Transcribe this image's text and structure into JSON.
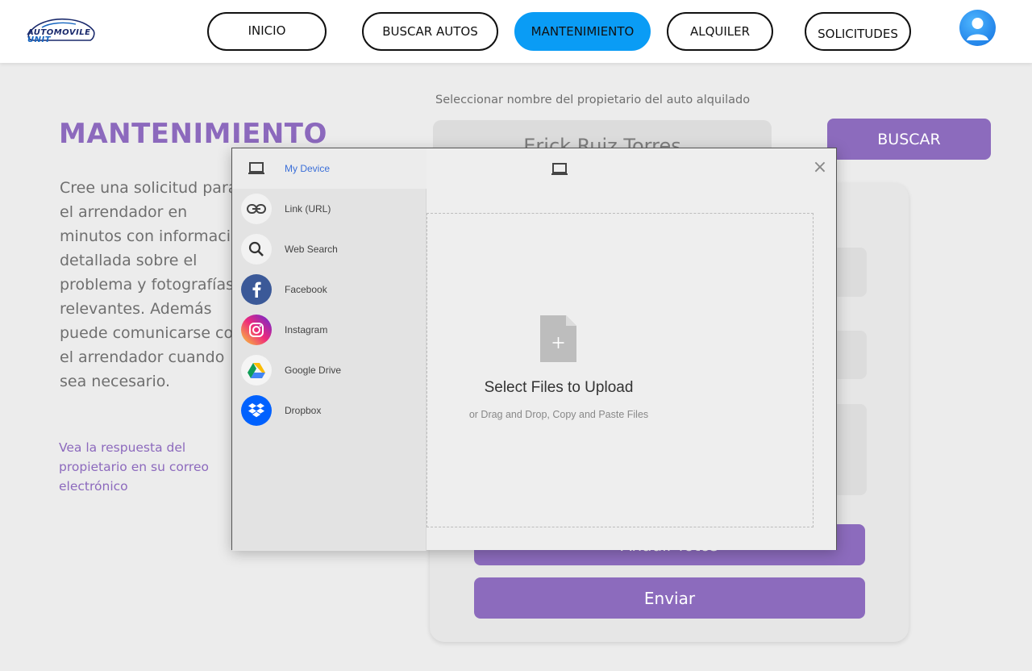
{
  "header": {
    "logo": {
      "line1": "AUTOMOVILE",
      "line2": "UNIT"
    },
    "nav": [
      {
        "label": "INICIO",
        "active": false
      },
      {
        "label": "BUSCAR AUTOS",
        "active": false
      },
      {
        "label": "MANTENIMIENTO",
        "active": true
      },
      {
        "label": "ALQUILER",
        "active": false
      },
      {
        "label": "SOLICITUDES",
        "active": false
      }
    ],
    "avatar_icon": "user-avatar-icon"
  },
  "page": {
    "title": "MANTENIMIENTO",
    "description": "Cree una solicitud para el arrendador en minutos con información detallada sobre el problema y fotografías relevantes. Además puede comunicarse con el arrendador cuando sea necesario.",
    "note": "Vea la respuesta del propietario en su correo electrónico"
  },
  "form": {
    "select_label": "Seleccionar  nombre del propietario del auto  alquilado",
    "selected_owner": "Erick Ruiz Torres",
    "search_button": "BUSCAR",
    "add_photos_button": "Añadir fotos",
    "submit_button": "Enviar"
  },
  "upload_modal": {
    "sources": [
      {
        "label": "My Device",
        "icon": "laptop-icon",
        "active": true
      },
      {
        "label": "Link (URL)",
        "icon": "link-icon",
        "active": false
      },
      {
        "label": "Web Search",
        "icon": "search-icon",
        "active": false
      },
      {
        "label": "Facebook",
        "icon": "facebook-icon",
        "active": false
      },
      {
        "label": "Instagram",
        "icon": "instagram-icon",
        "active": false
      },
      {
        "label": "Google Drive",
        "icon": "google-drive-icon",
        "active": false
      },
      {
        "label": "Dropbox",
        "icon": "dropbox-icon",
        "active": false
      }
    ],
    "drop_title": "Select Files to Upload",
    "drop_subtitle": "or Drag and Drop, Copy and Paste Files",
    "close_label": "×"
  },
  "colors": {
    "accent_purple": "#8c6bbd",
    "nav_active": "#0a9cf5",
    "facebook": "#3b5998",
    "dropbox": "#0061fe",
    "link_active": "#3b6fd8"
  }
}
